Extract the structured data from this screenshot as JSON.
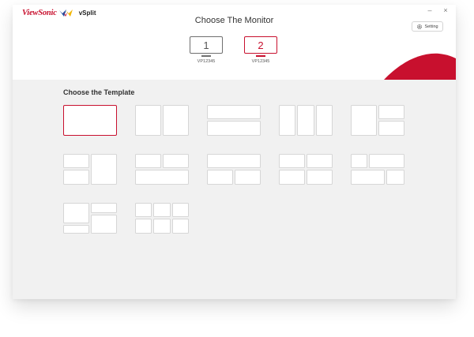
{
  "app": {
    "brand": "ViewSonic",
    "name": "vSplit",
    "minimize": "–",
    "close": "×"
  },
  "header": {
    "title": "Choose The Monitor",
    "setting_label": "Setting"
  },
  "monitors": [
    {
      "number": "1",
      "label": "VP12345",
      "selected": false
    },
    {
      "number": "2",
      "label": "VP12345",
      "selected": true
    }
  ],
  "templates": {
    "title": "Choose the Template",
    "selected_index": 0,
    "count": 12
  },
  "colors": {
    "accent": "#c8102e",
    "background": "#f1f1f1",
    "cell_border": "#d6d6d6"
  }
}
